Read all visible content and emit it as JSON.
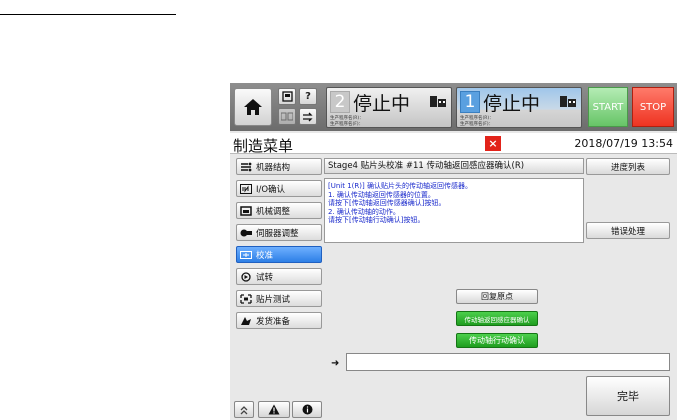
{
  "topbar": {
    "home_icon": "home-icon",
    "unit2": {
      "number": "2",
      "status": "停止中",
      "prog_line1": "生产程序名(R)：",
      "prog_line2": "生产程序名(F)："
    },
    "unit1": {
      "number": "1",
      "status": "停止中",
      "prog_line1": "生产程序名(R)：",
      "prog_line2": "生产程序名(F)："
    },
    "help_label": "?",
    "start_label": "START",
    "stop_label": "STOP",
    "colors": {
      "start": "#67c467",
      "stop": "#ee3321",
      "active_unit": "#5aa0e0"
    }
  },
  "titlebar": {
    "title": "制造菜单",
    "close_label": "×",
    "datetime": "2018/07/19 13:54"
  },
  "sidebar": {
    "items": [
      {
        "label": "机器结构",
        "icon": "machine-structure-icon",
        "active": false
      },
      {
        "label": "I/O确认",
        "icon": "io-icon",
        "active": false
      },
      {
        "label": "机械调整",
        "icon": "mechanical-adjust-icon",
        "active": false
      },
      {
        "label": "伺服器调整",
        "icon": "servo-icon",
        "active": false
      },
      {
        "label": "校准",
        "icon": "calibration-icon",
        "active": true
      },
      {
        "label": "试转",
        "icon": "trial-run-icon",
        "active": false
      },
      {
        "label": "贴片测试",
        "icon": "placement-test-icon",
        "active": false
      },
      {
        "label": "发货准备",
        "icon": "shipping-prep-icon",
        "active": false
      }
    ]
  },
  "panel": {
    "header": "Stage4 贴片头校准 #11 传动轴返回感应器确认(R)",
    "instructions": [
      "[Unit 1(R)] 确认贴片头的传动轴返回传感器。",
      "1.  确认传动轴返回传感器的位置。",
      "        请按下[传动轴返回传感器确认]按钮。",
      "2.  确认传动轴的动作。",
      "        请按下[传动轴行动确认]按钮。"
    ]
  },
  "right_buttons": {
    "progress_list": "进度列表",
    "error_handling": "错误处理"
  },
  "actions": {
    "return_origin": "回复原点",
    "sensor_confirm": "传动轴返回感应器确认",
    "move_confirm": "传动轴行动确认"
  },
  "command": {
    "arrow": "➜",
    "value": ""
  },
  "finish_label": "完毕"
}
